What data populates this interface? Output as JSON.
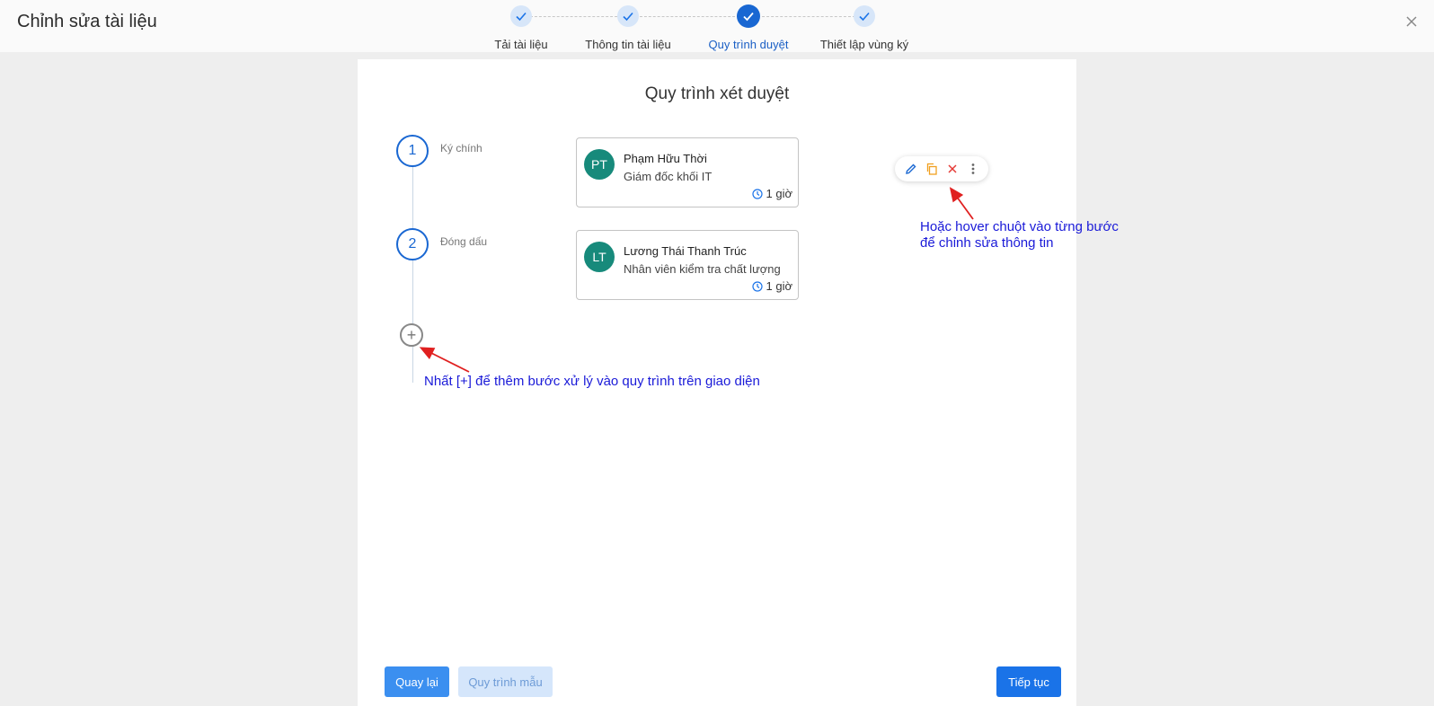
{
  "header": {
    "title": "Chỉnh sửa tài liệu"
  },
  "stepper": {
    "steps": [
      {
        "label": "Tải tài liệu",
        "state": "done"
      },
      {
        "label": "Thông tin tài liệu",
        "state": "done"
      },
      {
        "label": "Quy trình duyệt",
        "state": "active"
      },
      {
        "label": "Thiết lập vùng ký",
        "state": "done"
      }
    ]
  },
  "main": {
    "title": "Quy trình xét duyệt",
    "workflow_steps": [
      {
        "number": "1",
        "type": "Ký chính",
        "avatar": "PT",
        "name": "Phạm Hữu Thời",
        "role": "Giám đốc khối IT",
        "time": "1 giờ"
      },
      {
        "number": "2",
        "type": "Đóng dấu",
        "avatar": "LT",
        "name": "Lương Thái Thanh Trúc",
        "role": "Nhân viên kiểm tra chất lượng",
        "time": "1 giờ"
      }
    ],
    "add_step_symbol": "+",
    "annotations": {
      "add_hint": "Nhất [+] để thêm bước xử lý vào quy trình trên giao diện",
      "hover_hint_line1": "Hoặc hover chuột vào từng bước",
      "hover_hint_line2": "để chỉnh sửa thông tin"
    }
  },
  "footer": {
    "back_label": "Quay lại",
    "template_label": "Quy trình mẫu",
    "next_label": "Tiếp tục"
  },
  "colors": {
    "primary": "#1a73e8",
    "avatar": "#178a7b",
    "annotation_text": "#1a1ad8",
    "annotation_arrow": "#e02020",
    "edit_icon": "#1967d2",
    "copy_icon": "#f0a020",
    "delete_icon": "#e53935"
  },
  "icons": {
    "close": "close-icon",
    "step_done": "check-icon",
    "clock": "clock-icon",
    "edit": "pencil-icon",
    "copy": "copy-icon",
    "delete": "x-icon",
    "more": "more-vertical-icon"
  }
}
